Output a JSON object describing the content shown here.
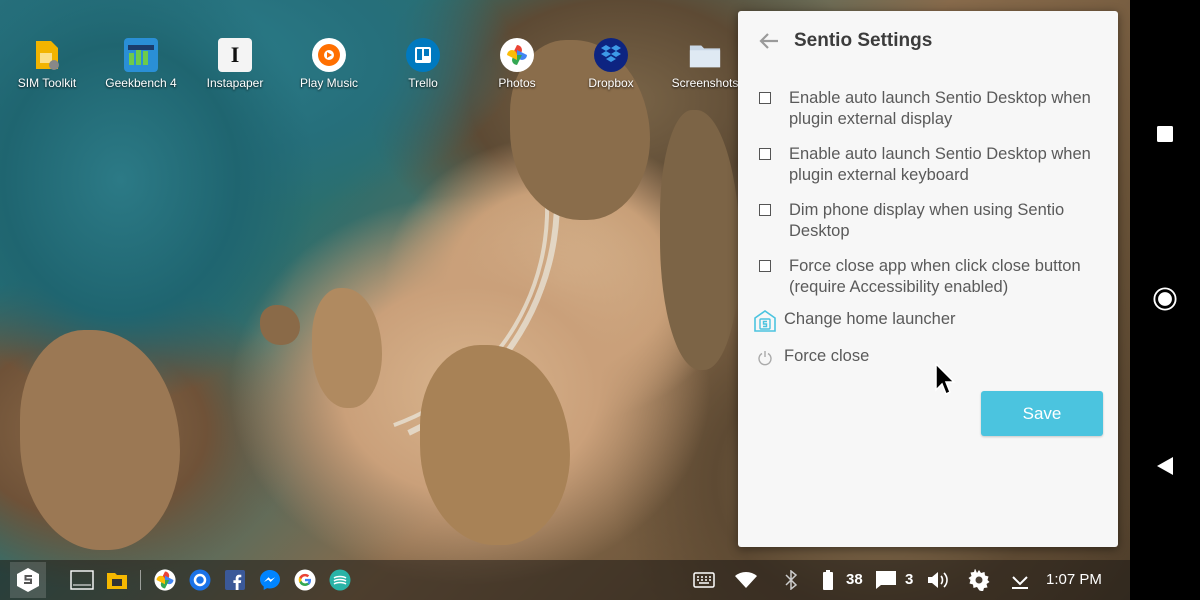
{
  "desktop_icons": [
    {
      "label": "SIM Toolkit",
      "icon": "sim-toolkit-icon"
    },
    {
      "label": "Geekbench 4",
      "icon": "geekbench-icon"
    },
    {
      "label": "Instapaper",
      "icon": "instapaper-icon"
    },
    {
      "label": "Play Music",
      "icon": "play-music-icon"
    },
    {
      "label": "Trello",
      "icon": "trello-icon"
    },
    {
      "label": "Photos",
      "icon": "photos-icon"
    },
    {
      "label": "Dropbox",
      "icon": "dropbox-icon"
    },
    {
      "label": "Screenshots",
      "icon": "folder-icon"
    }
  ],
  "settings": {
    "title": "Sentio Settings",
    "options": [
      {
        "label": "Enable auto launch Sentio Desktop when plugin external display",
        "checked": false
      },
      {
        "label": "Enable auto launch Sentio Desktop when plugin external keyboard",
        "checked": false
      },
      {
        "label": "Dim phone display when using Sentio Desktop",
        "checked": false
      },
      {
        "label": "Force close app when click close button (require Accessibility enabled)",
        "checked": false
      }
    ],
    "actions": [
      {
        "label": "Change home launcher",
        "icon": "sentio-home-icon"
      },
      {
        "label": "Force close",
        "icon": "power-icon"
      }
    ],
    "save_label": "Save"
  },
  "taskbar": {
    "battery_level": "38",
    "notification_count": "3",
    "time": "1:07 PM"
  },
  "colors": {
    "accent": "#4bc4df",
    "panel_bg": "#f7f7f7",
    "navbar_bg": "#000000"
  }
}
